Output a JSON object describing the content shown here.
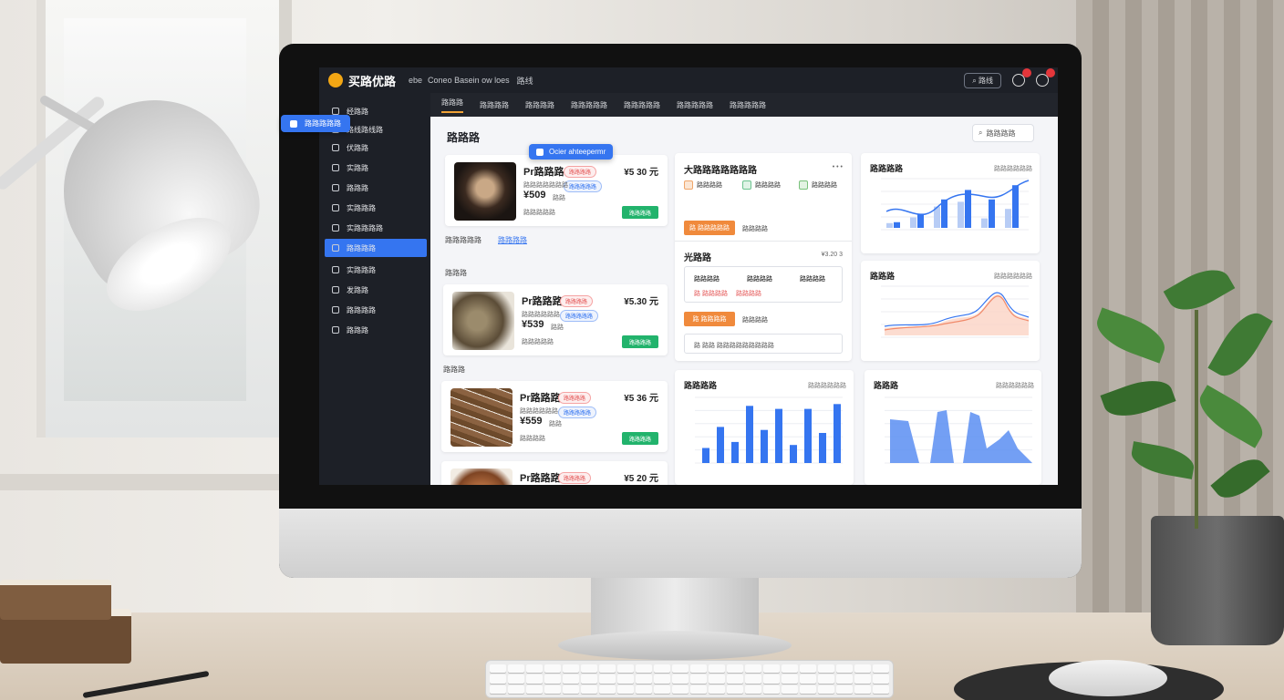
{
  "app": {
    "title": "买路优路",
    "subtitle_prefix": "ebe",
    "subtitle": "Coneo Basein ow loes",
    "subtitle_extra": "路线"
  },
  "topbar": {
    "search_label": "路线",
    "notification_count": "",
    "message_count": ""
  },
  "sidebar": {
    "items": [
      {
        "label": "经路路"
      },
      {
        "label": "路线路线路"
      },
      {
        "label": "伏路路"
      },
      {
        "label": "实路路"
      },
      {
        "label": "路路路"
      },
      {
        "label": "实路路路"
      },
      {
        "label": "实路路路路"
      },
      {
        "label": "路路路路"
      },
      {
        "label": "实路路路"
      },
      {
        "label": "发路路"
      },
      {
        "label": "路路路路"
      },
      {
        "label": "路路路"
      }
    ],
    "active_index": 7
  },
  "floating_tip": {
    "label": "路路路路路"
  },
  "tabs": [
    "路路路",
    "路路路路",
    "路路路路",
    "路路路路路",
    "路路路路路",
    "路路路路路",
    "路路路路路"
  ],
  "main": {
    "title": "路路路",
    "search_label": "路路路路",
    "tooltip": {
      "label": "Ocier ahteepermr"
    },
    "products": [
      {
        "name": "Pr路路路",
        "tag": "路路路路",
        "tag2": "路路路路路",
        "price": "¥509",
        "price_note": "路路",
        "meta": "路路路路路路路",
        "meta2": "路路路路路",
        "right_price": "¥5 30 元",
        "button": "路路路路"
      },
      {
        "name": "Pr路路路",
        "tag": "路路路路",
        "tag2": "路路路路路",
        "price": "¥539",
        "price_note": "路路",
        "meta": "路路路路路路",
        "meta2": "路路路路路",
        "right_price": "¥5.30 元",
        "button": "路路路路"
      },
      {
        "name": "Pr路路路",
        "tag": "路路路路",
        "tag2": "路路路路路",
        "price": "¥559",
        "price_note": "路路",
        "meta": "路路路路路路",
        "meta2": "路路路路",
        "right_price": "¥5 36 元",
        "button": "路路路路"
      },
      {
        "name": "Pr路路路",
        "tag": "路路路路",
        "right_price": "¥5 20 元"
      }
    ],
    "section1_label": "路路路路路",
    "section1_link": "路路路路",
    "section2_label": "路路路",
    "section3_label": "路路路",
    "summary": {
      "title": "大路路路路路路路",
      "more": "• • •",
      "stats": [
        "路路路路",
        "路路路路",
        "路路路路"
      ],
      "btn1": "路 路路路路路",
      "btn1_note": "路路路路",
      "section_title": "光路路",
      "section_value": "¥3.20 3",
      "box_row1": [
        "路路路路",
        "路路路路",
        "路路路路"
      ],
      "box_row2": [
        "路 路路路路",
        "路路路路"
      ],
      "btn2": "路 路路路路",
      "btn2_note": "路路路路",
      "box3": "路 路路 路路路路路路路路路"
    },
    "charts": {
      "c1": {
        "title": "路路路路",
        "sub": "路路路路路路"
      },
      "c2": {
        "title": "路路路",
        "sub": "路路路路路路"
      },
      "c3": {
        "title": "路路路路",
        "sub": "路路路路路路"
      },
      "c4": {
        "title": "路路路",
        "sub": "路路路路路路"
      }
    }
  },
  "colors": {
    "accent": "#3575f0",
    "green": "#22b36c",
    "orange": "#f08a3c",
    "sidebar": "#1d2027"
  }
}
